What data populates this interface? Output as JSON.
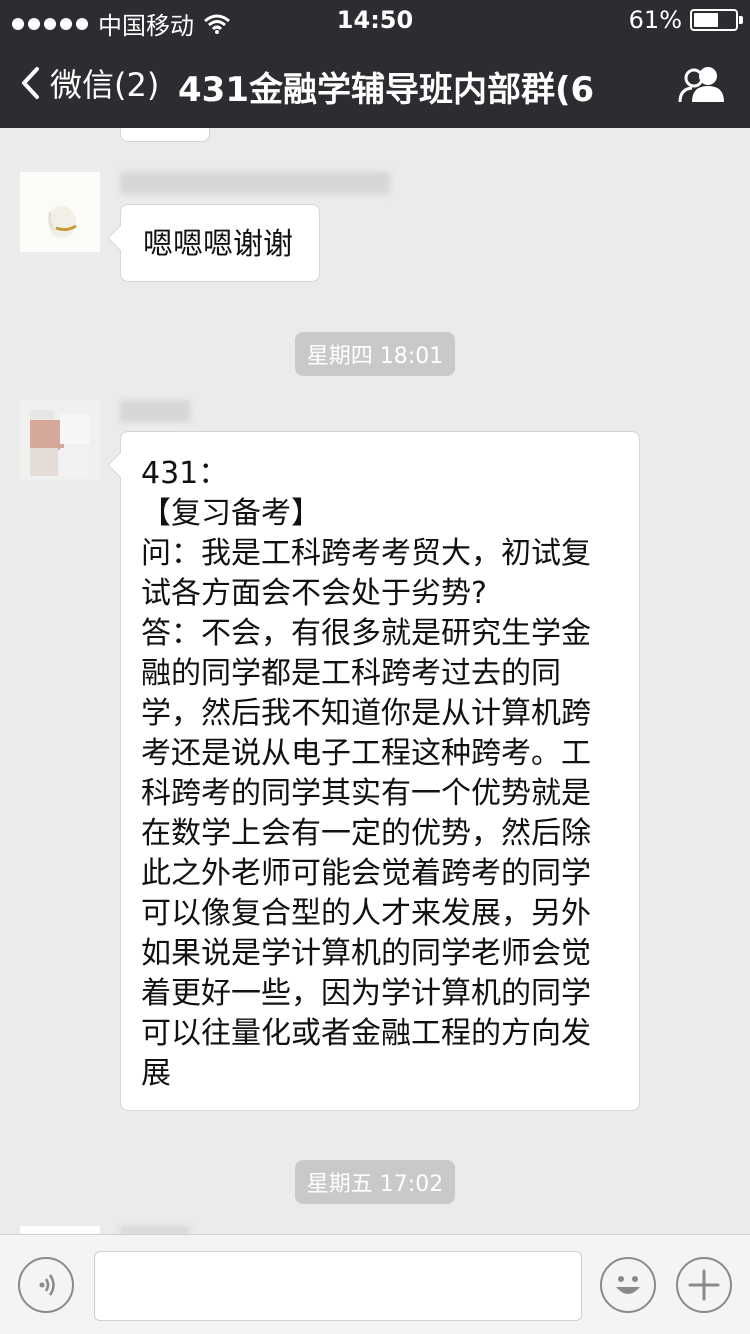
{
  "status_bar": {
    "carrier": "中国移动",
    "time": "14:50",
    "battery": "61%",
    "battery_level": 0.61
  },
  "nav": {
    "back_label": "微信(2)",
    "title": "431金融学辅导班内部群(6"
  },
  "chat": {
    "messages": [
      {
        "text": "嗯嗯嗯谢谢"
      },
      {
        "timestamp": "星期四 18:01"
      },
      {
        "text": "431：\n【复习备考】\n问：我是工科跨考考贸大，初试复\n试各方面会不会处于劣势?\n答：不会，有很多就是研究生学金\n融的同学都是工科跨考过去的同\n学，然后我不知道你是从计算机跨\n考还是说从电子工程这种跨考。工\n科跨考的同学其实有一个优势就是\n在数学上会有一定的优势，然后除\n此之外老师可能会觉着跨考的同学\n可以像复合型的人才来发展，另外\n如果说是学计算机的同学老师会觉\n着更好一些，因为学计算机的同学\n可以往量化或者金融工程的方向发\n展"
      },
      {
        "timestamp": "星期五 17:02"
      }
    ]
  },
  "colors": {
    "header_bg": "#2c2d31",
    "chat_bg": "#ebebeb",
    "bubble_bg": "#ffffff",
    "timestamp_bg": "#c9c9c9"
  },
  "icons": {
    "back": "chevron-left-icon",
    "group": "group-members-icon",
    "voice": "voice-icon",
    "emoji": "emoji-icon",
    "plus": "plus-icon",
    "wifi": "wifi-icon",
    "battery": "battery-icon"
  }
}
